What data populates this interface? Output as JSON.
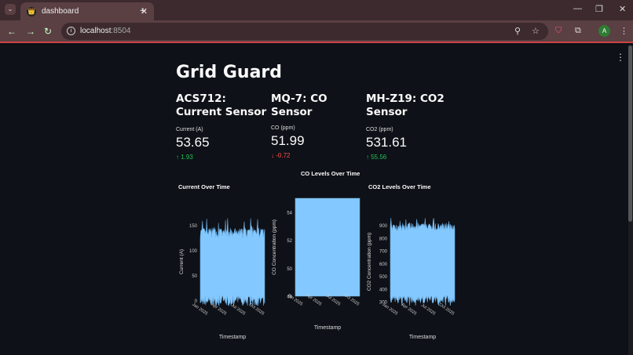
{
  "browser": {
    "tab_title": "dashboard",
    "url_host": "localhost",
    "url_port": ":8504",
    "profile_initial": "A"
  },
  "page": {
    "title": "Grid Guard"
  },
  "sensors": [
    {
      "heading": "ACS712: Current Sensor",
      "label": "Current (A)",
      "value": "53.65",
      "delta": "1.93",
      "direction": "up"
    },
    {
      "heading": "MQ-7: CO Sensor",
      "label": "CO (ppm)",
      "value": "51.99",
      "delta": "-0.72",
      "direction": "down"
    },
    {
      "heading": "MH-Z19: CO2 Sensor",
      "label": "CO2 (ppm)",
      "value": "531.61",
      "delta": "55.56",
      "direction": "up"
    }
  ],
  "colors": {
    "fill": "#83c9ff",
    "line": "#6aa9dc",
    "up": "#21c354",
    "down": "#ff4b4b"
  },
  "chart_data": [
    {
      "type": "area",
      "title": "Current Over Time",
      "xlabel": "Timestamp",
      "ylabel": "Current (A)",
      "xticks": [
        "Jan 2025",
        "Apr 2025",
        "Jul 2025",
        "Oct 2025"
      ],
      "yticks": [
        0,
        50,
        100,
        150
      ],
      "ylim": [
        -10,
        165
      ],
      "band": [
        0,
        135
      ],
      "noise": 10
    },
    {
      "type": "area",
      "title": "CO Levels Over Time",
      "xlabel": "Timestamp",
      "ylabel": "CO Concentration (ppm)",
      "xticks": [
        "Jan 2025",
        "Apr 2025",
        "Jul 2025",
        "Oct 2025"
      ],
      "yticks": [
        48,
        50,
        52,
        54
      ],
      "ylim": [
        48,
        55
      ],
      "band": [
        48,
        55
      ],
      "noise": 0
    },
    {
      "type": "area",
      "title": "CO2 Levels Over Time",
      "xlabel": "Timestamp",
      "ylabel": "CO2 Concentration (ppm)",
      "xticks": [
        "Jan 2025",
        "Apr 2025",
        "Jul 2025",
        "Oct 2025"
      ],
      "yticks": [
        300,
        400,
        500,
        600,
        700,
        800,
        900
      ],
      "ylim": [
        270,
        960
      ],
      "band": [
        320,
        890
      ],
      "noise": 30
    }
  ]
}
